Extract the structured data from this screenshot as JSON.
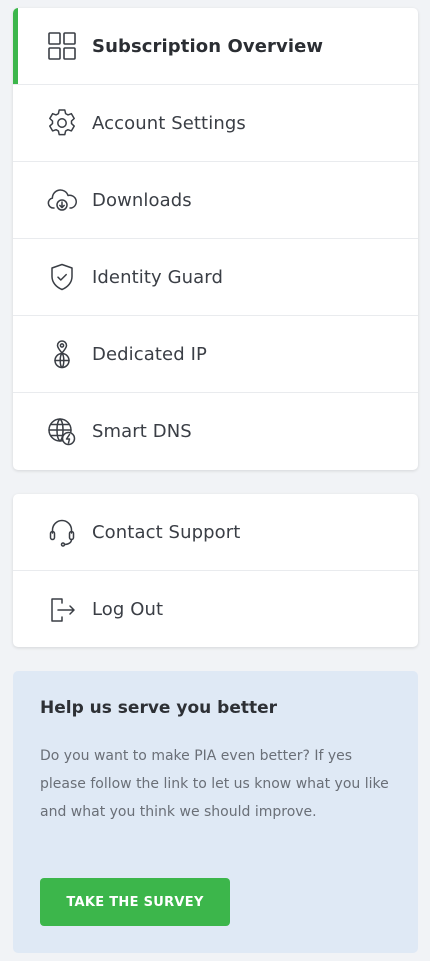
{
  "menu": {
    "items": [
      {
        "label": "Subscription Overview",
        "icon": "grid-icon",
        "active": true
      },
      {
        "label": "Account Settings",
        "icon": "gear-icon",
        "active": false
      },
      {
        "label": "Downloads",
        "icon": "cloud-download-icon",
        "active": false
      },
      {
        "label": "Identity Guard",
        "icon": "shield-check-icon",
        "active": false
      },
      {
        "label": "Dedicated IP",
        "icon": "location-globe-icon",
        "active": false
      },
      {
        "label": "Smart DNS",
        "icon": "globe-bolt-icon",
        "active": false
      }
    ]
  },
  "secondary_menu": {
    "items": [
      {
        "label": "Contact Support",
        "icon": "headset-icon"
      },
      {
        "label": "Log Out",
        "icon": "logout-icon"
      }
    ]
  },
  "survey": {
    "title": "Help us serve you better",
    "text": "Do you want to make PIA even better? If yes please follow the link to let us know what you like and what you think we should improve.",
    "button_label": "TAKE THE SURVEY"
  },
  "colors": {
    "accent": "#3cb64b",
    "survey_bg": "#dfe9f5",
    "page_bg": "#f1f3f6"
  }
}
